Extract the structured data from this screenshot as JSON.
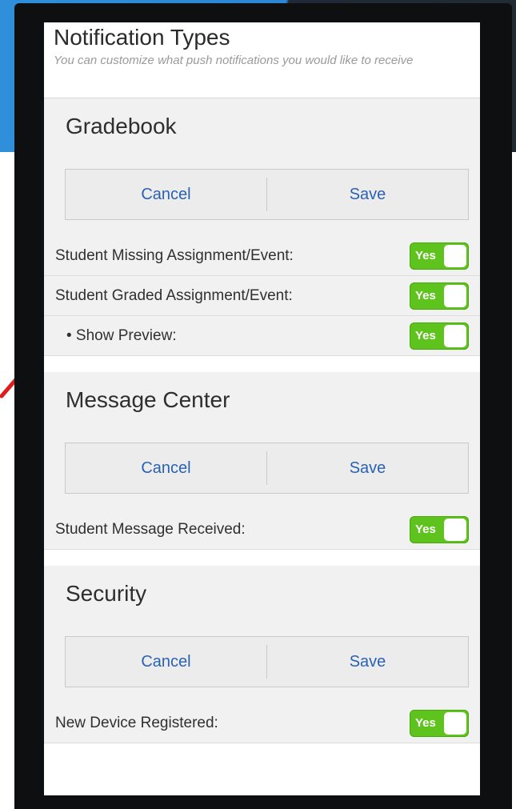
{
  "header": {
    "title": "Notification Types",
    "subtitle": "You can customize what push notifications you would like to receive"
  },
  "sections": [
    {
      "title": "Gradebook",
      "cancel_label": "Cancel",
      "save_label": "Save",
      "rows": [
        {
          "label": "Student Missing Assignment/Event:",
          "toggle": "Yes"
        },
        {
          "label": "Student Graded Assignment/Event:",
          "toggle": "Yes"
        },
        {
          "label": "• Show Preview:",
          "toggle": "Yes"
        }
      ]
    },
    {
      "title": "Message Center",
      "cancel_label": "Cancel",
      "save_label": "Save",
      "rows": [
        {
          "label": "Student Message Received:",
          "toggle": "Yes"
        }
      ]
    },
    {
      "title": "Security",
      "cancel_label": "Cancel",
      "save_label": "Save",
      "rows": [
        {
          "label": "New Device Registered:",
          "toggle": "Yes"
        }
      ]
    }
  ],
  "colors": {
    "toggle_on": "#5ec41d",
    "button_text": "#2a62b3",
    "background_blue": "#2b86d6",
    "arrow": "#e01b1b"
  },
  "icons": {
    "annotation": "red-arrow-icon"
  }
}
